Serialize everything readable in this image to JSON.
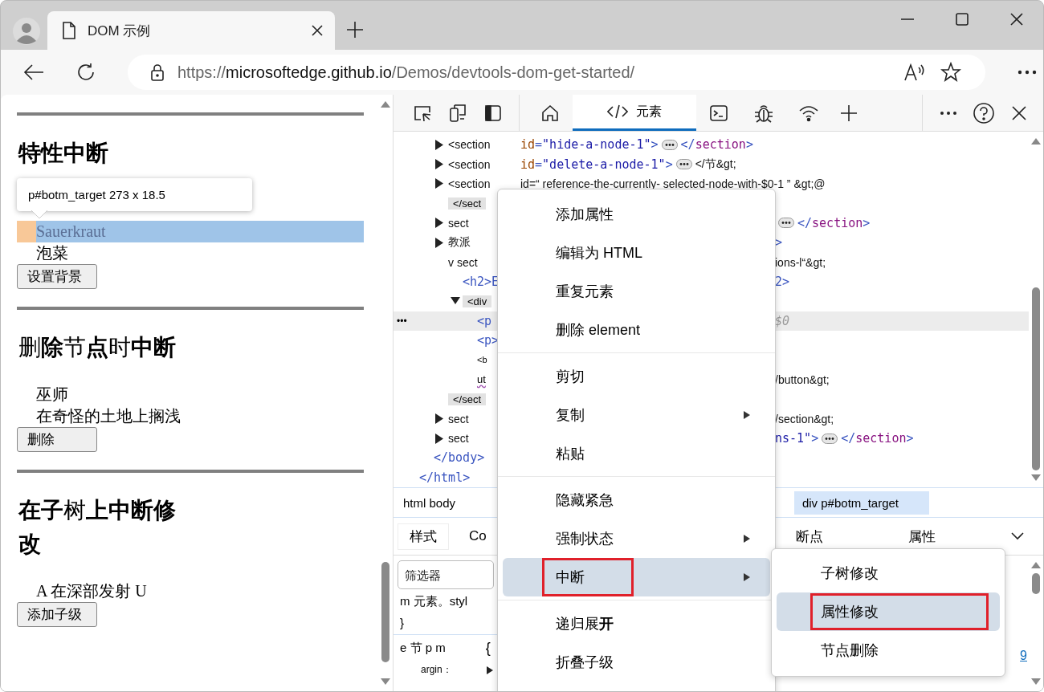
{
  "browser": {
    "tab": {
      "title": "DOM 示例",
      "selected": true
    },
    "url": {
      "scheme": "https://",
      "host": "microsoftedge.github.io",
      "path": "/Demos/devtools-dom-get-started/"
    }
  },
  "page": {
    "sections": [
      {
        "heading": "特性中断",
        "bold": true,
        "tooltip": "p#botm_target 273 x 18.5",
        "items": [
          {
            "text": "Sauerkraut",
            "selected": true
          },
          {
            "text": "泡菜",
            "selected": false
          }
        ],
        "button": "设置背景"
      },
      {
        "heading": "删**除**节**点**时**中断**",
        "bold": false,
        "items": [
          {
            "text": "巫师",
            "selected": false
          },
          {
            "text": "在奇怪的土地上搁浅",
            "selected": false
          }
        ],
        "button": "删除"
      },
      {
        "heading": "**在子**树**上中断修改**",
        "bold": false,
        "items": [
          {
            "text": "A 在深部发射 U",
            "selected": false
          }
        ],
        "button": "添加子级"
      }
    ]
  },
  "devtools": {
    "toolbar_tabs": [
      {
        "kind": "home",
        "selected": false
      },
      {
        "kind": "elements",
        "label": "元素",
        "selected": true
      },
      {
        "kind": "console",
        "selected": false
      },
      {
        "kind": "bug",
        "selected": false
      },
      {
        "kind": "network",
        "selected": false
      }
    ],
    "dom_tree": [
      {
        "children": [
          {
            "children": [
              {
                "label": "<section",
                "kind": "plain",
                "expandable": true,
                "expanded": false,
                "selected": false,
                "code": [
                  {
                    "kind": "attr",
                    "text": "id"
                  },
                  {
                    "kind": "punct",
                    "text": "="
                  },
                  {
                    "kind": "value",
                    "text": "\"hide-a-node-1\""
                  },
                  {
                    "kind": "punct",
                    "text": ">"
                  },
                  {
                    "kind": "ellipsis"
                  },
                  {
                    "kind": "punct",
                    "text": "</"
                  },
                  {
                    "kind": "tag",
                    "text": "section"
                  },
                  {
                    "kind": "punct",
                    "text": ">"
                  }
                ]
              },
              {
                "label": "<section",
                "kind": "plain",
                "expandable": true,
                "expanded": false,
                "selected": false,
                "code": [
                  {
                    "kind": "attr",
                    "text": "id"
                  },
                  {
                    "kind": "punct",
                    "text": "="
                  },
                  {
                    "kind": "value",
                    "text": "\"delete-a-node-1\""
                  },
                  {
                    "kind": "punct",
                    "text": ">"
                  },
                  {
                    "kind": "ellipsis"
                  },
                  {
                    "kind": "plain",
                    "text": "</节&gt;"
                  }
                ]
              },
              {
                "label": "<section",
                "kind": "plain",
                "expandable": true,
                "expanded": false,
                "selected": false,
                "code": [
                  {
                    "kind": "plain",
                    "text": "id=“ reference-the-currently- selected-node-with-$0-1 ” &gt;@"
                  }
                ],
                "close": {
                  "label": "</sect",
                  "kind": "closing"
                }
              },
              {
                "label": "sect",
                "kind": "plain",
                "expandable": true,
                "expanded": false,
                "selected": false,
                "code": [
                  {
                    "kind": "ellipsis"
                  },
                  {
                    "kind": "punct",
                    "text": "</"
                  },
                  {
                    "kind": "tag",
                    "text": "section"
                  },
                  {
                    "kind": "punct",
                    "text": ">"
                  }
                ]
              },
              {
                "label": "教派",
                "kind": "plain",
                "expandable": true,
                "expanded": false,
                "selected": false,
                "code": [
                  {
                    "kind": "punct",
                    "text": ">"
                  }
                ]
              },
              {
                "label": "v sect",
                "kind": "plain",
                "selected": false,
                "code": [
                  {
                    "kind": "plain",
                    "text": "ions-l“&gt;"
                  }
                ],
                "children": [
                  {
                    "label": "<h2>E",
                    "kind": "tag",
                    "selected": false,
                    "code": [
                      {
                        "kind": "punct",
                        "text": "2>"
                      }
                    ]
                  },
                  {
                    "label": "<div",
                    "kind": "closing",
                    "expandable": true,
                    "expanded": true,
                    "selected": false,
                    "children": [
                      {
                        "label": "<p",
                        "kind": "tag",
                        "selected": true,
                        "gutter": "•••",
                        "code": [
                          {
                            "kind": "dollar",
                            "text": "$0"
                          }
                        ]
                      },
                      {
                        "label": "<p>",
                        "kind": "tag",
                        "selected": false
                      },
                      {
                        "label": "<b",
                        "kind": "small",
                        "selected": false
                      },
                      {
                        "label": "ut",
                        "kind": "squiggle",
                        "selected": false,
                        "code": [
                          {
                            "kind": "plain",
                            "text": "/button&gt;"
                          }
                        ]
                      }
                    ]
                  }
                ],
                "close": {
                  "label": "</sect",
                  "kind": "closing"
                }
              },
              {
                "label": "sect",
                "kind": "plain",
                "expandable": true,
                "expanded": false,
                "selected": false,
                "code": [
                  {
                    "kind": "plain",
                    "text": "/section&gt;"
                  }
                ]
              },
              {
                "label": "sect",
                "kind": "plain",
                "expandable": true,
                "expanded": false,
                "selected": false,
                "code": [
                  {
                    "kind": "value",
                    "text": "ns-1\""
                  },
                  {
                    "kind": "punct",
                    "text": ">"
                  },
                  {
                    "kind": "ellipsis"
                  },
                  {
                    "kind": "punct",
                    "text": "</"
                  },
                  {
                    "kind": "tag",
                    "text": "section"
                  },
                  {
                    "kind": "punct",
                    "text": ">"
                  }
                ]
              }
            ],
            "close": {
              "label": "</body>",
              "kind": "tag"
            }
          }
        ],
        "close": {
          "label": "</html>",
          "kind": "tag"
        }
      }
    ],
    "breadcrumbs": [
      {
        "text": "html body",
        "selected": false
      },
      {
        "text": "div p#botm_target",
        "selected": true
      }
    ],
    "lower_tabs": [
      {
        "label": "样式",
        "selected": true
      },
      {
        "label": "Co",
        "selected": false
      },
      {
        "label": "断点",
        "selected": false
      },
      {
        "label": "属性",
        "selected": false
      }
    ],
    "styles": {
      "filter_placeholder": "筛选器",
      "source_link": "9",
      "rules": [
        {
          "lines": [
            {
              "text": "m 元素。styl",
              "expander": false
            },
            {
              "text": "}",
              "expander": false
            }
          ]
        },
        {
          "lines": [
            {
              "text": "e 节 p m",
              "extra": "{",
              "expander": false
            },
            {
              "text": "argin：",
              "expander": true
            }
          ]
        }
      ]
    },
    "context_menu": {
      "items": [
        {
          "kind": "item",
          "label": "添加属性",
          "submenu": false,
          "selected": false
        },
        {
          "kind": "item",
          "label": "编辑为 HTML",
          "submenu": false,
          "selected": false
        },
        {
          "kind": "item",
          "label": "重复元素",
          "submenu": false,
          "selected": false
        },
        {
          "kind": "item",
          "label": "删除    element",
          "submenu": false,
          "selected": false
        },
        {
          "kind": "separator"
        },
        {
          "kind": "item",
          "label": "剪切",
          "submenu": false,
          "selected": false
        },
        {
          "kind": "item",
          "label": "复制",
          "submenu": true,
          "selected": false
        },
        {
          "kind": "item",
          "label": "粘贴",
          "submenu": false,
          "selected": false
        },
        {
          "kind": "separator"
        },
        {
          "kind": "item",
          "label": "隐藏紧急",
          "submenu": false,
          "selected": false
        },
        {
          "kind": "item",
          "label": "强制状态",
          "submenu": true,
          "selected": false
        },
        {
          "kind": "item",
          "label": "中断",
          "submenu": true,
          "selected": true
        },
        {
          "kind": "separator"
        },
        {
          "kind": "item",
          "label": "递归展**开**",
          "submenu": false,
          "selected": false
        },
        {
          "kind": "item",
          "label": "折叠子级",
          "submenu": false,
          "selected": false
        }
      ]
    },
    "submenu": {
      "items": [
        {
          "label": "子树修改",
          "selected": false
        },
        {
          "label": "属性修改",
          "selected": true
        },
        {
          "label": "节点删除",
          "selected": false
        }
      ]
    }
  }
}
